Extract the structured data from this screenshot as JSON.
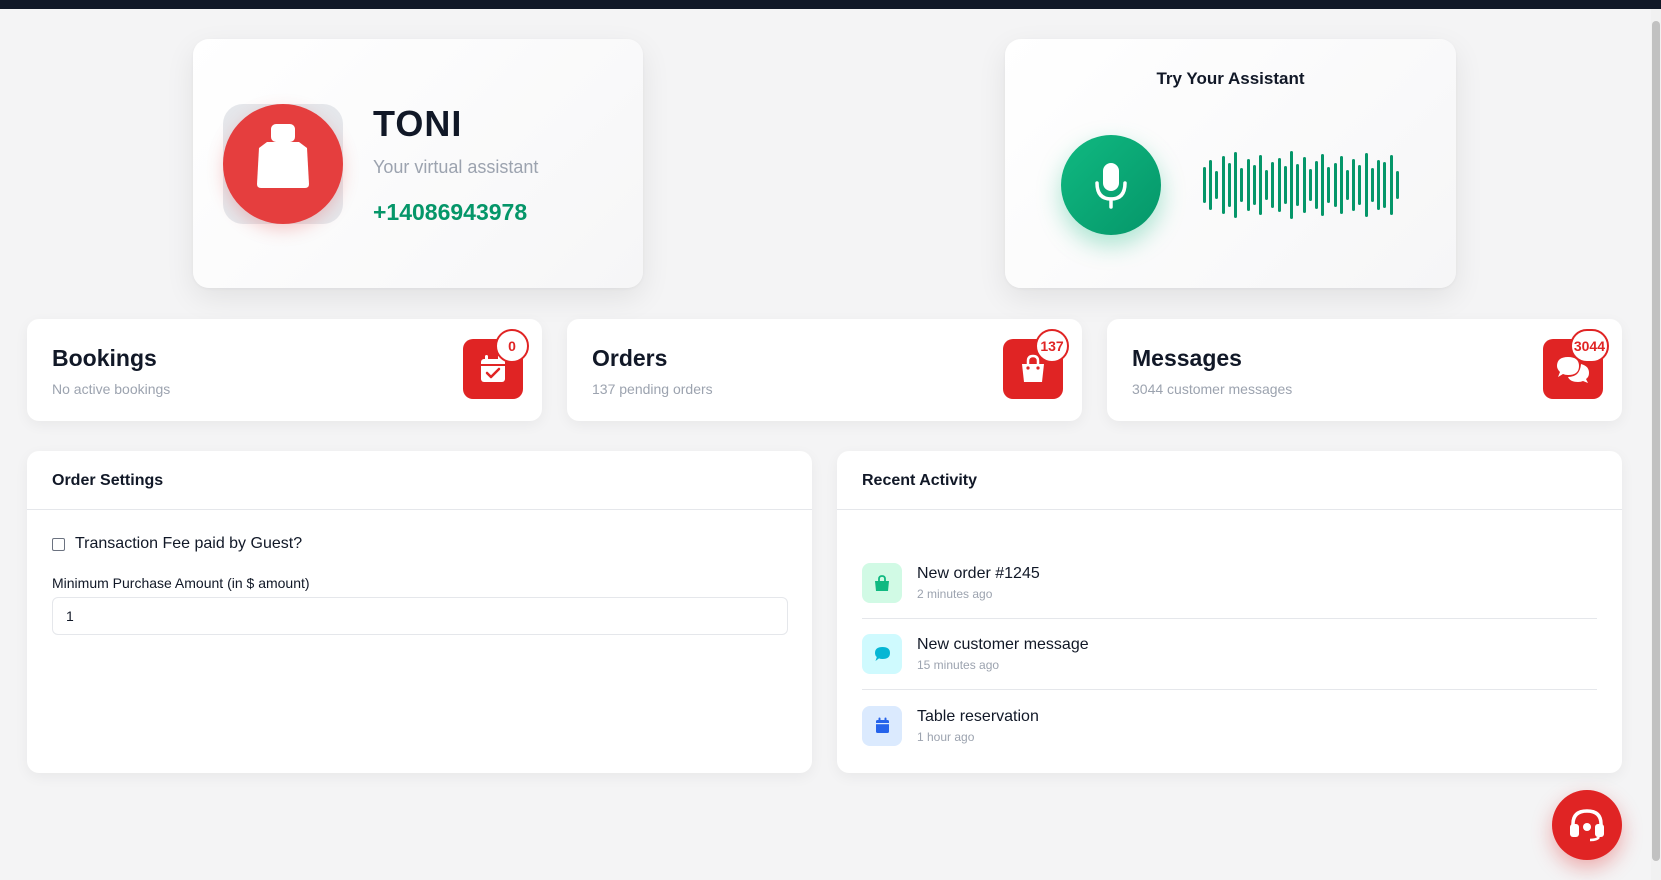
{
  "assistant": {
    "name": "TONI",
    "subtitle": "Your virtual assistant",
    "phone": "+14086943978",
    "avatar_icon": "robot-icon",
    "avatar_color": "#e53e3e"
  },
  "try_assistant": {
    "title": "Try Your Assistant",
    "mic_icon": "microphone-icon",
    "accent_color": "#059669"
  },
  "stats": {
    "bookings": {
      "title": "Bookings",
      "subtitle": "No active bookings",
      "count": "0",
      "icon": "calendar-check-icon"
    },
    "orders": {
      "title": "Orders",
      "subtitle": "137 pending orders",
      "count": "137",
      "icon": "shopping-bag-icon"
    },
    "messages": {
      "title": "Messages",
      "subtitle": "3044 customer messages",
      "count": "3044",
      "icon": "chat-bubbles-icon"
    }
  },
  "order_settings": {
    "title": "Order Settings",
    "transaction_fee_label": "Transaction Fee paid by Guest?",
    "transaction_fee_checked": false,
    "min_purchase_label": "Minimum Purchase Amount (in $ amount)",
    "min_purchase_value": "1"
  },
  "recent_activity": {
    "title": "Recent Activity",
    "items": [
      {
        "title": "New order #1245",
        "time": "2 minutes ago",
        "icon": "shopping-bag-icon",
        "color": "#10b981"
      },
      {
        "title": "New customer message",
        "time": "15 minutes ago",
        "icon": "chat-bubble-icon",
        "color": "#06b6d4"
      },
      {
        "title": "Table reservation",
        "time": "1 hour ago",
        "icon": "calendar-icon",
        "color": "#2563eb"
      }
    ]
  },
  "support_button": {
    "icon": "headset-icon",
    "color": "#e02424"
  }
}
